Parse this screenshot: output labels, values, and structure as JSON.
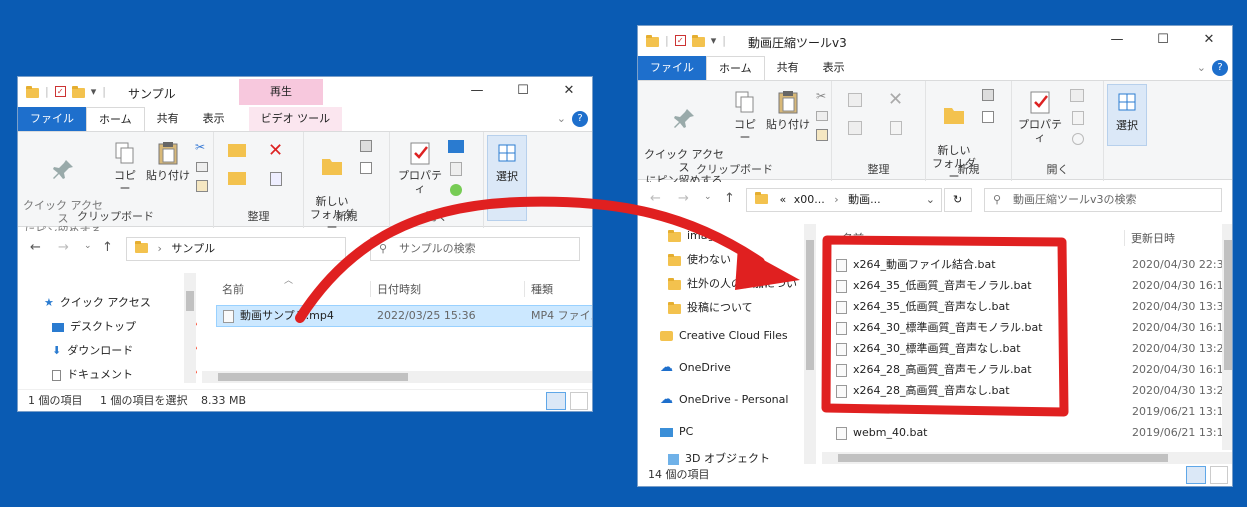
{
  "w1": {
    "title": "サンプル",
    "context_tab_group": "再生",
    "tabs": [
      "ファイル",
      "ホーム",
      "共有",
      "表示",
      "ビデオ ツール"
    ],
    "ribbon": {
      "pin": "クイック アクセス\nにピン留めする",
      "copy": "コピー",
      "paste": "貼り付け",
      "clipboard": "クリップボード",
      "organize": "整理",
      "new_folder": "新しい\nフォルダー",
      "new": "新規",
      "properties": "プロパティ",
      "open": "開く",
      "select": "選択"
    },
    "address": "サンプル",
    "search_placeholder": "サンプルの検索",
    "sidebar": [
      {
        "label": "クイック アクセス",
        "icon": "star-icon"
      },
      {
        "label": "デスクトップ",
        "icon": "desktop-icon"
      },
      {
        "label": "ダウンロード",
        "icon": "download-icon"
      },
      {
        "label": "ドキュメント",
        "icon": "document-icon"
      }
    ],
    "columns": [
      "名前",
      "日付時刻",
      "種類"
    ],
    "file": {
      "name": "動画サンプル.mp4",
      "date": "2022/03/25 15:36",
      "type": "MP4 ファイル"
    },
    "status": {
      "count": "1 個の項目",
      "selected": "1 個の項目を選択",
      "size": "8.33 MB"
    }
  },
  "w2": {
    "title": "動画圧縮ツールv3",
    "tabs": [
      "ファイル",
      "ホーム",
      "共有",
      "表示"
    ],
    "ribbon": {
      "pin": "クイック アクセス\nにピン留めする",
      "copy": "コピー",
      "paste": "貼り付け",
      "clipboard": "クリップボード",
      "organize": "整理",
      "new_folder": "新しい\nフォルダー",
      "new": "新規",
      "properties": "プロパティ",
      "open": "開く",
      "select": "選択"
    },
    "address_prefix": "«",
    "address_parts": [
      "x00...",
      "動画..."
    ],
    "search_placeholder": "動画圧縮ツールv3の検索",
    "sidebar": [
      {
        "label": "image",
        "icon": "folder-icon"
      },
      {
        "label": "使わない",
        "icon": "folder-icon"
      },
      {
        "label": "社外の人の参加につい",
        "icon": "folder-icon"
      },
      {
        "label": "投稿について",
        "icon": "folder-icon"
      },
      {
        "label": "Creative Cloud Files",
        "icon": "creative-cloud-icon"
      },
      {
        "label": "OneDrive",
        "icon": "onedrive-icon"
      },
      {
        "label": "OneDrive - Personal",
        "icon": "onedrive-icon"
      },
      {
        "label": "PC",
        "icon": "pc-icon"
      },
      {
        "label": "3D オブジェクト",
        "icon": "3d-objects-icon"
      }
    ],
    "columns": [
      "名前",
      "更新日時"
    ],
    "files": [
      {
        "name": "x264_動画ファイル結合.bat",
        "date": "2020/04/30 22:3"
      },
      {
        "name": "x264_35_低画質_音声モノラル.bat",
        "date": "2020/04/30 16:1"
      },
      {
        "name": "x264_35_低画質_音声なし.bat",
        "date": "2020/04/30 13:3"
      },
      {
        "name": "x264_30_標準画質_音声モノラル.bat",
        "date": "2020/04/30 16:1"
      },
      {
        "name": "x264_30_標準画質_音声なし.bat",
        "date": "2020/04/30 13:2"
      },
      {
        "name": "x264_28_高画質_音声モノラル.bat",
        "date": "2020/04/30 16:1"
      },
      {
        "name": "x264_28_高画質_音声なし.bat",
        "date": "2020/04/30 13:2"
      },
      {
        "name": "",
        "date": "2019/06/21 13:1"
      },
      {
        "name": "webm_40.bat",
        "date": "2019/06/21 13:1"
      }
    ],
    "status": "14 個の項目"
  },
  "colors": {
    "desktop": "#0a5bb3",
    "file_tab": "#1e6fcc",
    "highlight": "#cce8ff",
    "annotation": "#e02020",
    "context_tab": "#f7c8dd"
  }
}
